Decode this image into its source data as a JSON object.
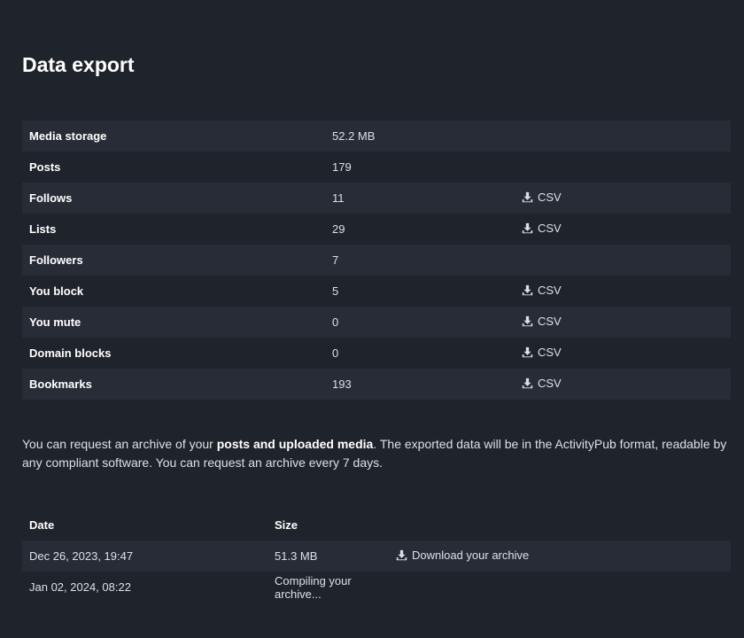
{
  "page": {
    "title": "Data export"
  },
  "stats": [
    {
      "label": "Media storage",
      "value": "52.2 MB",
      "action": ""
    },
    {
      "label": "Posts",
      "value": "179",
      "action": ""
    },
    {
      "label": "Follows",
      "value": "11",
      "action": "CSV"
    },
    {
      "label": "Lists",
      "value": "29",
      "action": "CSV"
    },
    {
      "label": "Followers",
      "value": "7",
      "action": ""
    },
    {
      "label": "You block",
      "value": "5",
      "action": "CSV"
    },
    {
      "label": "You mute",
      "value": "0",
      "action": "CSV"
    },
    {
      "label": "Domain blocks",
      "value": "0",
      "action": "CSV"
    },
    {
      "label": "Bookmarks",
      "value": "193",
      "action": "CSV"
    }
  ],
  "info": {
    "before": "You can request an archive of your ",
    "bold": "posts and uploaded media",
    "after": ". The exported data will be in the ActivityPub format, readable by any compliant software. You can request an archive every 7 days."
  },
  "archives": {
    "headers": {
      "date": "Date",
      "size": "Size"
    },
    "rows": [
      {
        "date": "Dec 26, 2023, 19:47",
        "size": "51.3 MB",
        "action": "Download your archive"
      },
      {
        "date": "Jan 02, 2024, 08:22",
        "size": "Compiling your archive...",
        "action": ""
      }
    ]
  },
  "icons": {
    "download": "download-icon"
  },
  "colors": {
    "background": "#1f232b",
    "row_stripe": "#282c37",
    "text": "#d9e1e8",
    "heading": "#ffffff"
  }
}
